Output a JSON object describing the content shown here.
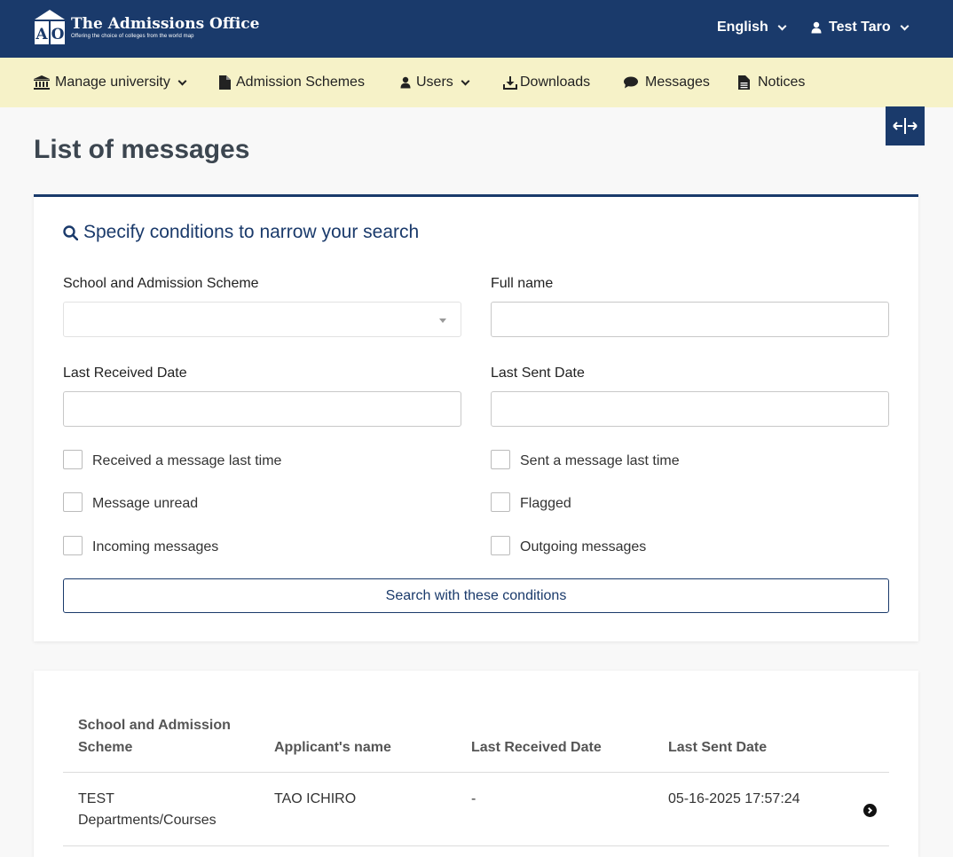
{
  "header": {
    "brand_title": "The Admissions Office",
    "brand_subtitle": "Offering the choice of colleges from the world map",
    "logo_letters": "AO",
    "language": "English",
    "user_name": "Test Taro"
  },
  "nav": {
    "items": [
      {
        "label": "Manage university",
        "icon": "university-icon",
        "dropdown": true
      },
      {
        "label": "Admission Schemes",
        "icon": "file-icon",
        "dropdown": false
      },
      {
        "label": "Users",
        "icon": "user-icon",
        "dropdown": true
      },
      {
        "label": "Downloads",
        "icon": "download-icon",
        "dropdown": false
      },
      {
        "label": "Messages",
        "icon": "comment-icon",
        "dropdown": false
      },
      {
        "label": "Notices",
        "icon": "file-text-icon",
        "dropdown": false
      }
    ]
  },
  "page": {
    "title": "List of messages"
  },
  "search": {
    "heading": "Specify conditions to narrow your search",
    "school_label": "School and Admission Scheme",
    "school_value": "",
    "fullname_label": "Full name",
    "fullname_value": "",
    "last_received_label": "Last Received Date",
    "last_received_value": "",
    "last_sent_label": "Last Sent Date",
    "last_sent_value": "",
    "checkboxes": [
      {
        "label": "Received a message last time",
        "checked": false
      },
      {
        "label": "Sent a message last time",
        "checked": false
      },
      {
        "label": "Message unread",
        "checked": false
      },
      {
        "label": "Flagged",
        "checked": false
      },
      {
        "label": "Incoming messages",
        "checked": false
      },
      {
        "label": "Outgoing messages",
        "checked": false
      }
    ],
    "submit_label": "Search with these conditions"
  },
  "table": {
    "columns": [
      "School and Admission Scheme",
      "Applicant's name",
      "Last Received Date",
      "Last Sent Date"
    ],
    "rows": [
      {
        "school": "TEST Departments/Courses",
        "applicant": "TAO ICHIRO",
        "last_received": "-",
        "last_sent": "05-16-2025 17:57:24"
      }
    ]
  },
  "colors": {
    "primary": "#1a3a6b",
    "nav_bg": "#f6f2c8",
    "page_bg": "#f8f8f8"
  }
}
